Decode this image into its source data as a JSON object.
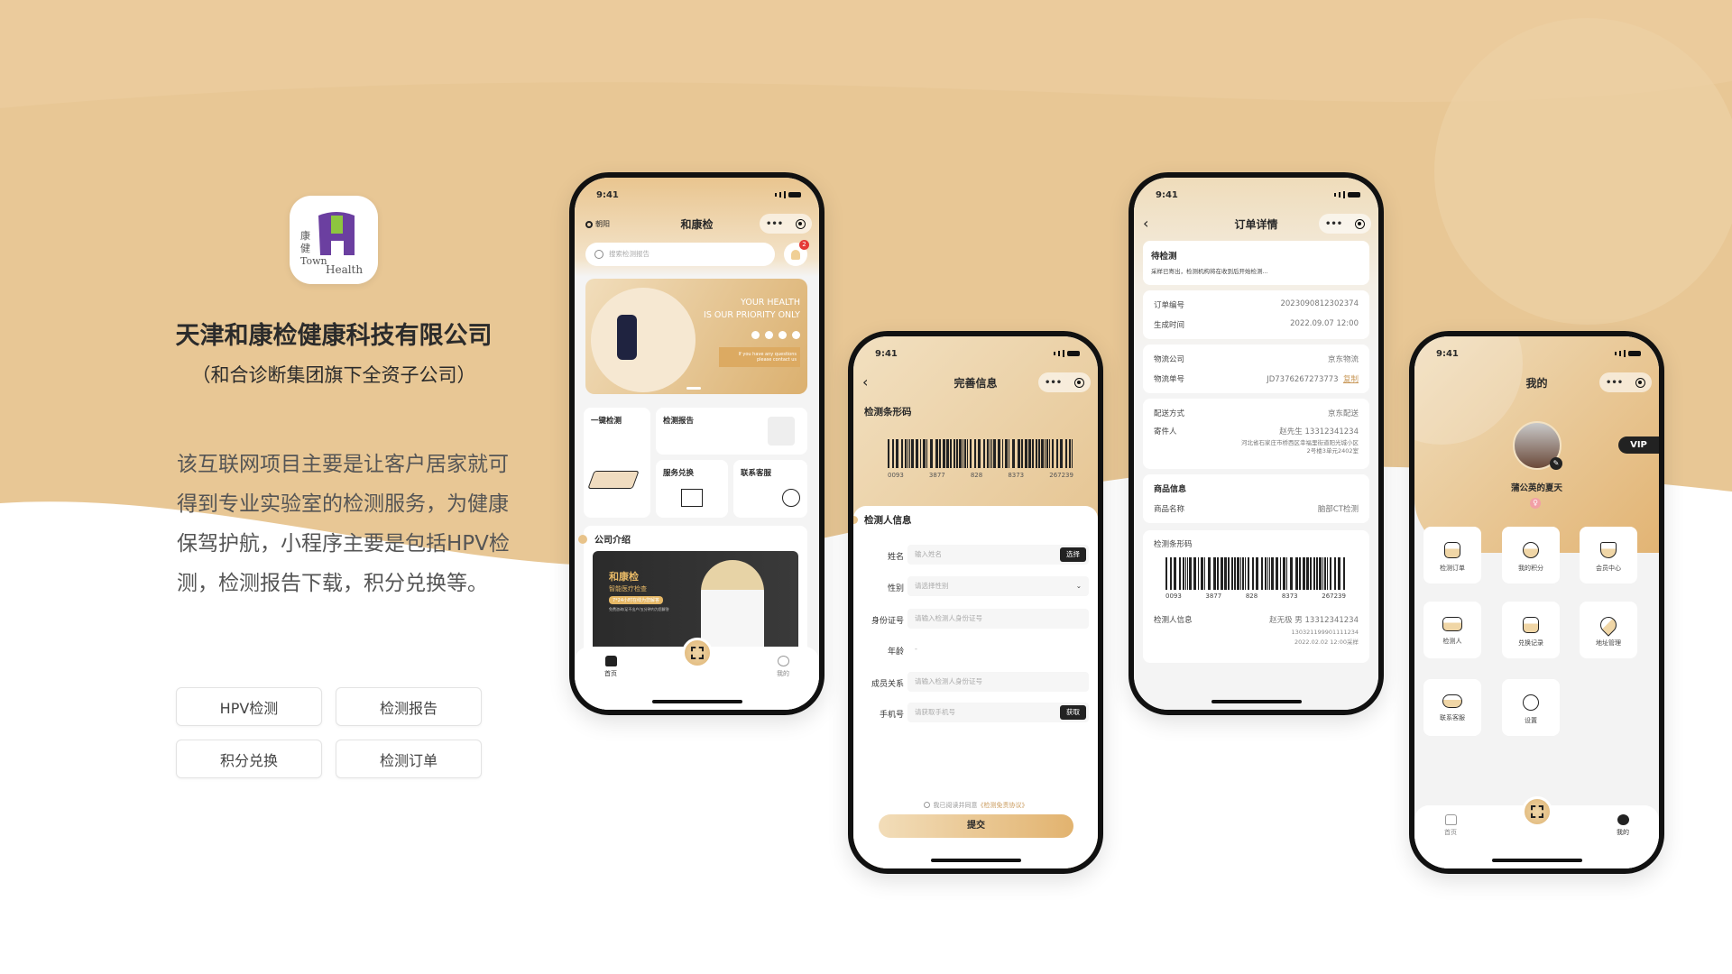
{
  "colors": {
    "brand_tan": "#e8c795",
    "dark": "#222222",
    "accent_gold": "#c9995a"
  },
  "left": {
    "logo": {
      "cn": "康健",
      "en1": "Town",
      "en2": "Health"
    },
    "company": "天津和康检健康科技有限公司",
    "subsidiary": "（和合诊断集团旗下全资子公司）",
    "description": "该互联网项目主要是让客户居家就可得到专业实验室的检测服务，为健康保驾护航，小程序主要是包括HPV检测，检测报告下载，积分兑换等。",
    "tags": [
      "HPV检测",
      "检测报告",
      "积分兑换",
      "检测订单"
    ]
  },
  "status_time": "9:41",
  "p1": {
    "location": "朝阳",
    "title": "和康检",
    "search_placeholder": "搜索检测报告",
    "bell_badge": "2",
    "banner": {
      "line1": "YOUR HEALTH",
      "line2": "IS OUR PRIORITY ONLY",
      "contact1": "If you have any questions",
      "contact2": "please contact us"
    },
    "grid": [
      {
        "label": "一键检测"
      },
      {
        "label": "检测报告"
      },
      {
        "label": "服务兑换"
      },
      {
        "label": "联系客服"
      }
    ],
    "intro": {
      "heading": "公司介绍",
      "brand": "和康检",
      "tagline": "智能医疗检查",
      "pill": "7*24小时在线为您解答",
      "small": "免费咨询/足不出户/五分钟内为您解答"
    },
    "tabs": [
      "首页",
      "我的"
    ]
  },
  "p2": {
    "title": "完善信息",
    "barcode_heading": "检测条形码",
    "barcode_digits": [
      "0093",
      "3877",
      "828",
      "8373",
      "267239"
    ],
    "section": "检测人信息",
    "fields": [
      {
        "label": "姓名",
        "placeholder": "输入姓名",
        "button": "选择"
      },
      {
        "label": "性别",
        "placeholder": "请选择性别"
      },
      {
        "label": "身份证号",
        "placeholder": "请输入检测人身份证号"
      },
      {
        "label": "年龄",
        "value": "-"
      },
      {
        "label": "成员关系",
        "placeholder": "请输入检测人身份证号"
      },
      {
        "label": "手机号",
        "placeholder": "请获取手机号",
        "button": "获取"
      }
    ],
    "agree_prefix": "我已阅读并同意",
    "agree_link": "《检测免责协议》",
    "submit": "提交"
  },
  "p3": {
    "title": "订单详情",
    "status": "待检测",
    "status_desc": "采样已寄出，检测机构将在收到后开始检测...",
    "order_no_label": "订单编号",
    "order_no": "2023090812302374",
    "created_label": "生成时间",
    "created": "2022.09.07 12:00",
    "logistics_label": "物流公司",
    "logistics": "京东物流",
    "tracking_label": "物流单号",
    "tracking": "JD7376267273773",
    "copy": "复制",
    "delivery_label": "配送方式",
    "delivery": "京东配送",
    "sender_label": "寄件人",
    "sender": "赵先生  13312341234",
    "address1": "河北省石家庄市桥西区幸福里街道阳光城小区",
    "address2": "2号楼3单元2402室",
    "goods_heading": "商品信息",
    "goods_label": "商品名称",
    "goods": "脑部CT检测",
    "barcode_heading": "检测条形码",
    "barcode_digits": [
      "0093",
      "3877",
      "828",
      "8373",
      "267239"
    ],
    "person_label": "检测人信息",
    "person": "赵无极  男  13312341234",
    "person_id": "130321199901111234",
    "sampled": "2022.02.02 12:00采样"
  },
  "p4": {
    "title": "我的",
    "vip": "VIP",
    "nickname": "蒲公英的夏天",
    "menu": [
      {
        "label": "检测订单"
      },
      {
        "label": "我的积分"
      },
      {
        "label": "会员中心"
      },
      {
        "label": "检测人"
      },
      {
        "label": "兑换记录"
      },
      {
        "label": "地址管理"
      },
      {
        "label": "联系客服"
      },
      {
        "label": "设置"
      }
    ],
    "tabs": [
      "首页",
      "我的"
    ]
  }
}
